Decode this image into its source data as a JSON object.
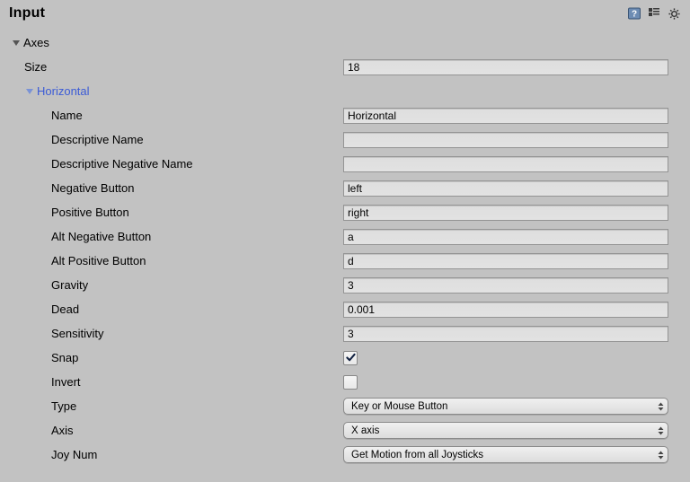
{
  "title": "Input",
  "axes": {
    "label": "Axes",
    "size_label": "Size",
    "size_value": "18",
    "entries": [
      {
        "title": "Horizontal",
        "fields": {
          "name": {
            "label": "Name",
            "value": "Horizontal"
          },
          "descName": {
            "label": "Descriptive Name",
            "value": ""
          },
          "descNegName": {
            "label": "Descriptive Negative Name",
            "value": ""
          },
          "negButton": {
            "label": "Negative Button",
            "value": "left"
          },
          "posButton": {
            "label": "Positive Button",
            "value": "right"
          },
          "altNegButton": {
            "label": "Alt Negative Button",
            "value": "a"
          },
          "altPosButton": {
            "label": "Alt Positive Button",
            "value": "d"
          },
          "gravity": {
            "label": "Gravity",
            "value": "3"
          },
          "dead": {
            "label": "Dead",
            "value": "0.001"
          },
          "sensitivity": {
            "label": "Sensitivity",
            "value": "3"
          },
          "snap": {
            "label": "Snap",
            "checked": true
          },
          "invert": {
            "label": "Invert",
            "checked": false
          },
          "type": {
            "label": "Type",
            "value": "Key or Mouse Button"
          },
          "axis": {
            "label": "Axis",
            "value": "X axis"
          },
          "joyNum": {
            "label": "Joy Num",
            "value": "Get Motion from all Joysticks"
          }
        }
      }
    ]
  }
}
